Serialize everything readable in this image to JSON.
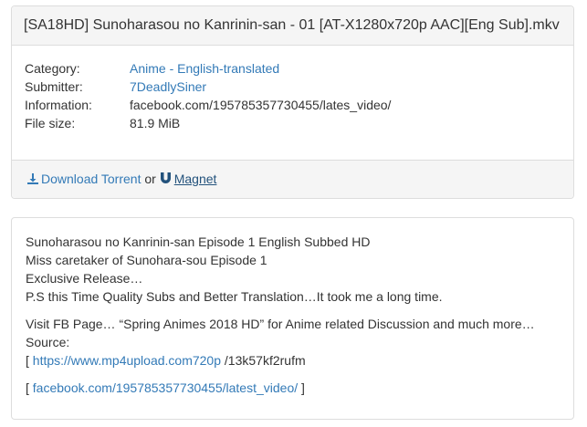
{
  "title": "[SA18HD] Sunoharasou no Kanrinin-san - 01 [AT-X1280x720p AAC][Eng Sub].mkv",
  "info": {
    "category_label": "Category:",
    "category_main": "Anime",
    "category_sep": " - ",
    "category_sub": "English-translated",
    "submitter_label": "Submitter:",
    "submitter": "7DeadlySiner",
    "information_label": "Information:",
    "information": "facebook.com/195785357730455/lates_video/",
    "filesize_label": "File size:",
    "filesize": "81.9 MiB"
  },
  "footer": {
    "download_icon": "download-icon",
    "download_label": "Download Torrent",
    "or": " or ",
    "magnet_icon": "magnet-icon",
    "magnet_label": "Magnet"
  },
  "description": {
    "line1": "Sunoharasou no Kanrinin-san Episode 1 English Subbed HD",
    "line2": "Miss caretaker of Sunohara-sou Episode 1",
    "line3": "Exclusive Release…",
    "line4": "P.S this Time Quality Subs and Better Translation…It took me a long time.",
    "line5": "Visit FB Page… “Spring Animes 2018 HD” for Anime related Discussion and much more…",
    "line6": "Source:",
    "link1_open": "[ ",
    "link1": "https://www.mp4upload.com720p",
    "link1_rest": " /13k57kf2rufm",
    "link2_open": "[ ",
    "link2": "facebook.com/195785357730455/latest_video/",
    "link2_close": " ]"
  },
  "colors": {
    "link": "#337ab7",
    "panel_bg": "#f5f5f5",
    "border": "#dddddd",
    "text": "#333333"
  }
}
